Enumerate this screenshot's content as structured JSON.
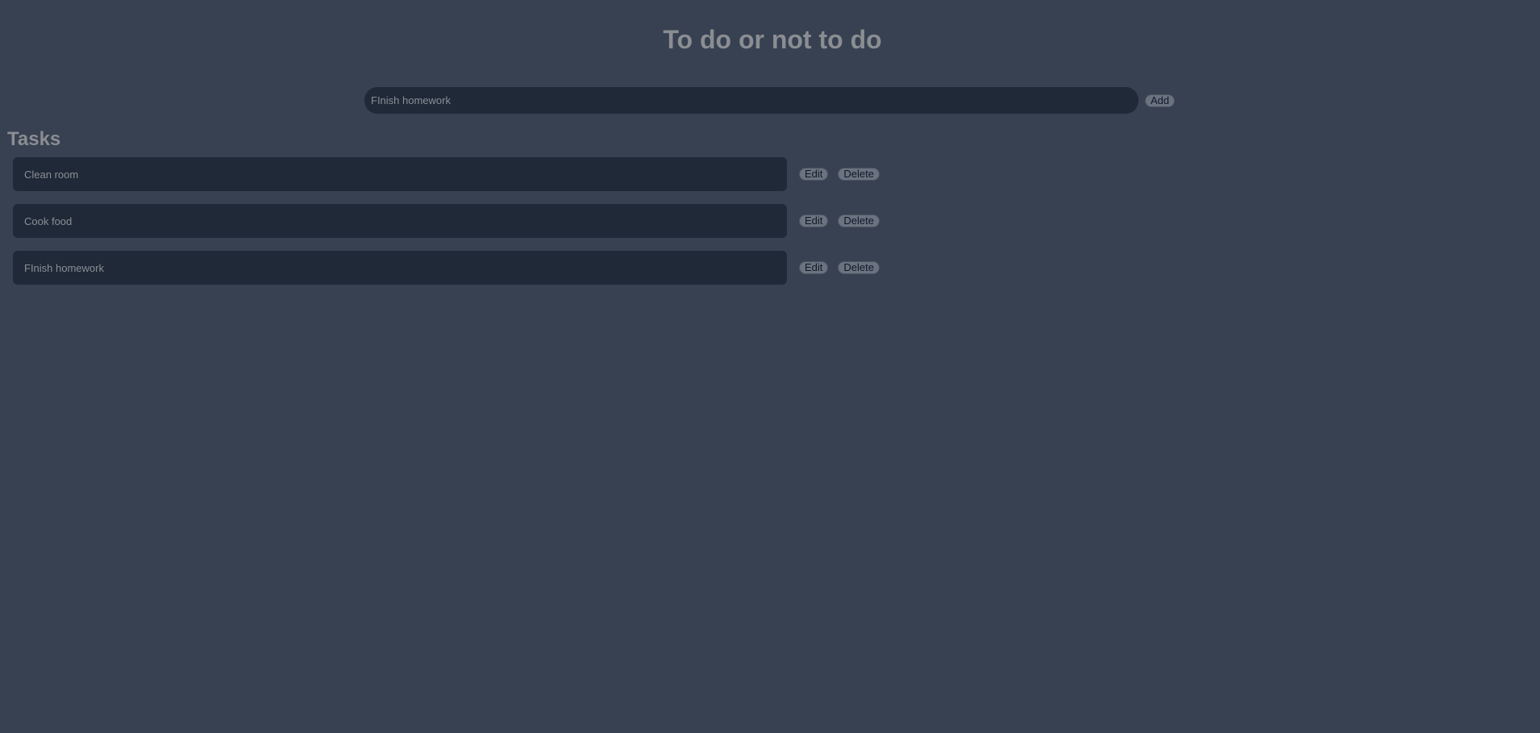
{
  "header": {
    "title": "To do or not to do"
  },
  "new_task": {
    "value": "FInish homework",
    "add_label": "Add"
  },
  "tasks_section": {
    "heading": "Tasks",
    "edit_label": "Edit",
    "delete_label": "Delete",
    "items": [
      {
        "text": "Clean room"
      },
      {
        "text": "Cook food"
      },
      {
        "text": "FInish homework"
      }
    ]
  }
}
